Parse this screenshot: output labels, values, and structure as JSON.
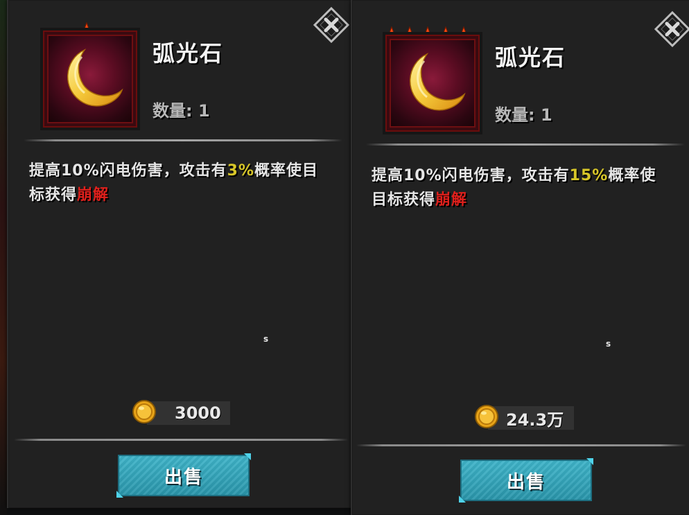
{
  "colors": {
    "highlight": "#d7c628",
    "status_red": "#e0201c",
    "button": "#2a96ab",
    "star": "#ff4a12"
  },
  "cards": [
    {
      "stars": 1,
      "item_icon": "crescent-moon-icon",
      "title": "弧光石",
      "quantity": "数量: 1",
      "desc_pre": "提高10%闪电伤害，攻击有",
      "desc_pct": "3%",
      "desc_mid": "概率使目",
      "desc_line2_pre": "标获得",
      "desc_effect": "崩解",
      "tiny_mark": "s",
      "price": "3000",
      "sell_label": "出售",
      "close_icon": "close-icon"
    },
    {
      "stars": 5,
      "item_icon": "crescent-moon-icon",
      "title": "弧光石",
      "quantity": "数量: 1",
      "desc_pre": "提高10%闪电伤害，攻击有",
      "desc_pct": "15%",
      "desc_mid": "概率使",
      "desc_line2_pre": "目标获得",
      "desc_effect": "崩解",
      "tiny_mark": "s",
      "price": "24.3万",
      "sell_label": "出售",
      "close_icon": "close-icon"
    }
  ]
}
